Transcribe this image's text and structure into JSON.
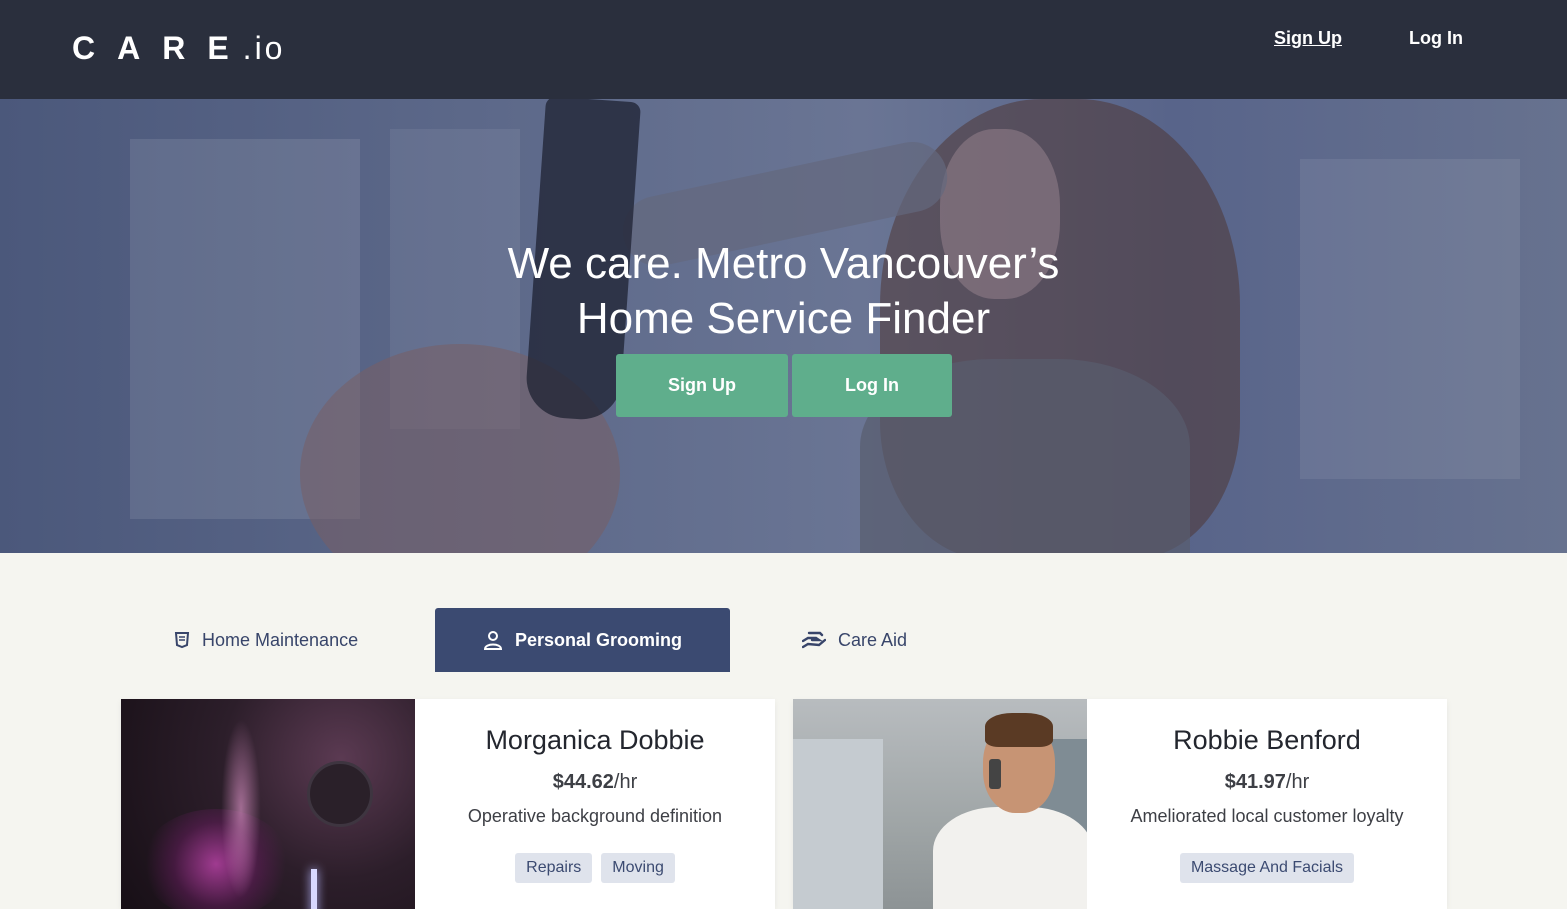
{
  "header": {
    "logo_main": "CARE",
    "logo_tld": ".io",
    "signup_label": "Sign Up",
    "login_label": "Log In"
  },
  "hero": {
    "title_line1": "We care. Metro Vancouver’s",
    "title_line2": "Home Service Finder",
    "signup_label": "Sign Up",
    "login_label": "Log In",
    "button_color": "#5fae8c"
  },
  "tabs": [
    {
      "label": "Home Maintenance",
      "icon": "shield-icon",
      "active": false
    },
    {
      "label": "Personal Grooming",
      "icon": "person-icon",
      "active": true
    },
    {
      "label": "Care Aid",
      "icon": "hand-holding-icon",
      "active": false
    }
  ],
  "cards": [
    {
      "name": "Morganica Dobbie",
      "rate": "$44.62",
      "rate_unit": "/hr",
      "description": "Operative background definition",
      "tags": [
        "Repairs",
        "Moving"
      ]
    },
    {
      "name": "Robbie Benford",
      "rate": "$41.97",
      "rate_unit": "/hr",
      "description": "Ameliorated local customer loyalty",
      "tags": [
        "Massage And Facials"
      ]
    }
  ],
  "colors": {
    "nav_bg": "#2a2f3d",
    "accent": "#3b4a71",
    "button_green": "#5fae8c",
    "page_bg": "#f5f5f0"
  }
}
